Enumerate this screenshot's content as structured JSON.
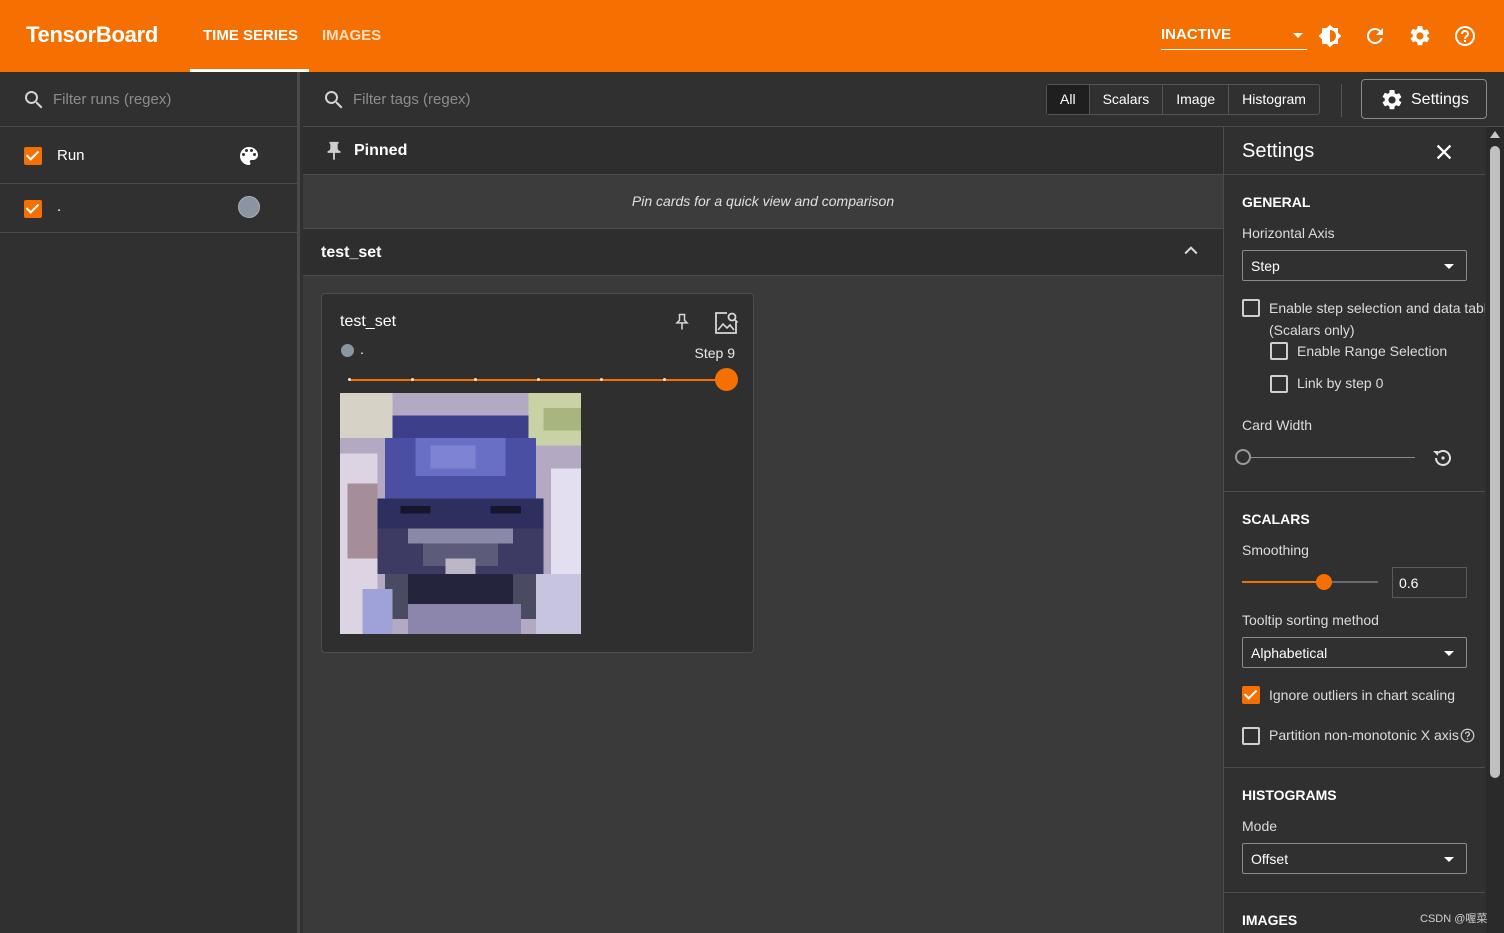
{
  "app": {
    "title": "TensorBoard",
    "tabs": [
      "TIME SERIES",
      "IMAGES"
    ],
    "active_tab": "TIME SERIES",
    "status_select": "INACTIVE",
    "accent_color": "#f57000"
  },
  "runs_panel": {
    "filter_placeholder": "Filter runs (regex)",
    "header_label": "Run",
    "runs": [
      {
        "name": ".",
        "checked": true,
        "color": "#8a94a3"
      }
    ]
  },
  "toolbar": {
    "tags_placeholder": "Filter tags (regex)",
    "type_filters": [
      "All",
      "Scalars",
      "Image",
      "Histogram"
    ],
    "active_filter": "All",
    "settings_label": "Settings"
  },
  "pinned": {
    "title": "Pinned",
    "empty_message": "Pin cards for a quick view and comparison"
  },
  "group": {
    "title": "test_set"
  },
  "card": {
    "title": "test_set",
    "run_name": ".",
    "step_label": "Step 9",
    "step_fraction": 1.0
  },
  "settings_panel": {
    "title": "Settings",
    "general": {
      "heading": "GENERAL",
      "horizontal_axis_label": "Horizontal Axis",
      "horizontal_axis_value": "Step",
      "step_selection_label_1": "Enable step selection and data table",
      "step_selection_label_2": "(Scalars only)",
      "range_selection_label": "Enable Range Selection",
      "link_by_step_label": "Link by step 0",
      "card_width_label": "Card Width"
    },
    "scalars": {
      "heading": "SCALARS",
      "smoothing_label": "Smoothing",
      "smoothing_value": "0.6",
      "smoothing_fraction": 0.6,
      "tooltip_sort_label": "Tooltip sorting method",
      "tooltip_sort_value": "Alphabetical",
      "ignore_outliers_label": "Ignore outliers in chart scaling",
      "partition_label": "Partition non-monotonic X axis"
    },
    "histograms": {
      "heading": "HISTOGRAMS",
      "mode_label": "Mode",
      "mode_value": "Offset"
    },
    "images": {
      "heading": "IMAGES"
    }
  },
  "watermark": "CSDN @喔菜"
}
